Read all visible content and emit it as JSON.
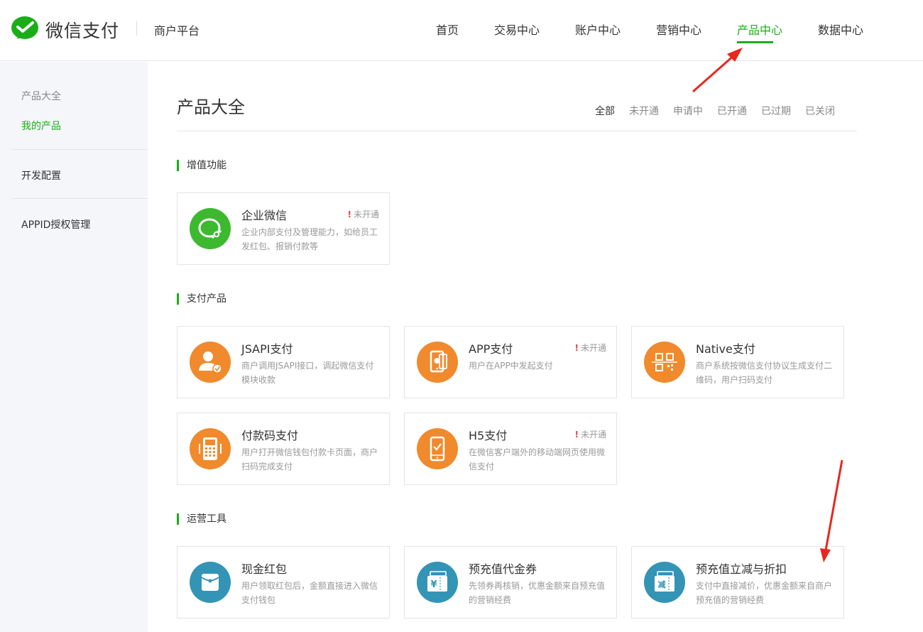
{
  "header": {
    "brand": "微信支付",
    "platform": "商户平台",
    "nav": [
      "首页",
      "交易中心",
      "账户中心",
      "营销中心",
      "产品中心",
      "数据中心"
    ],
    "active_nav": "产品中心"
  },
  "sidebar": {
    "section_label": "产品大全",
    "my_products": "我的产品",
    "dev_config": "开发配置",
    "appid_mgmt": "APPID授权管理"
  },
  "main": {
    "title": "产品大全",
    "filters": [
      "全部",
      "未开通",
      "申请中",
      "已开通",
      "已过期",
      "已关闭"
    ],
    "active_filter": "全部"
  },
  "sections": {
    "value_added": {
      "title": "增值功能",
      "cards": [
        {
          "name": "企业微信",
          "desc": "企业内部支付及管理能力，如给员工发红包、报销付款等",
          "status": "未开通"
        }
      ]
    },
    "payment": {
      "title": "支付产品",
      "cards": [
        {
          "name": "JSAPI支付",
          "desc": "商户调用JSAPI接口，调起微信支付模块收款",
          "status": ""
        },
        {
          "name": "APP支付",
          "desc": "用户在APP中发起支付",
          "status": "未开通"
        },
        {
          "name": "Native支付",
          "desc": "商户系统按微信支付协议生成支付二维码，用户扫码支付",
          "status": ""
        },
        {
          "name": "付款码支付",
          "desc": "用户打开微信钱包付款卡页面，商户扫码完成支付",
          "status": ""
        },
        {
          "name": "H5支付",
          "desc": "在微信客户端外的移动端网页使用微信支付",
          "status": "未开通"
        }
      ]
    },
    "operations": {
      "title": "运营工具",
      "cards": [
        {
          "name": "现金红包",
          "desc": "用户领取红包后，金额直接进入微信支付钱包",
          "status": ""
        },
        {
          "name": "预充值代金券",
          "desc": "先领券再核销，优惠金额来自预充值的营销经费",
          "status": ""
        },
        {
          "name": "预充值立减与折扣",
          "desc": "支付中直接减价，优惠金额来自商户预充值的营销经费",
          "status": ""
        }
      ]
    }
  },
  "icon_text": {
    "voucher": "¥",
    "discount": "减"
  },
  "colors": {
    "accent_green": "#1aad19",
    "icon_green": "#3cb92f",
    "icon_orange": "#f08a2c",
    "icon_teal": "#3494b5",
    "status_red": "#e64340",
    "annotation_red": "#e8271f"
  }
}
